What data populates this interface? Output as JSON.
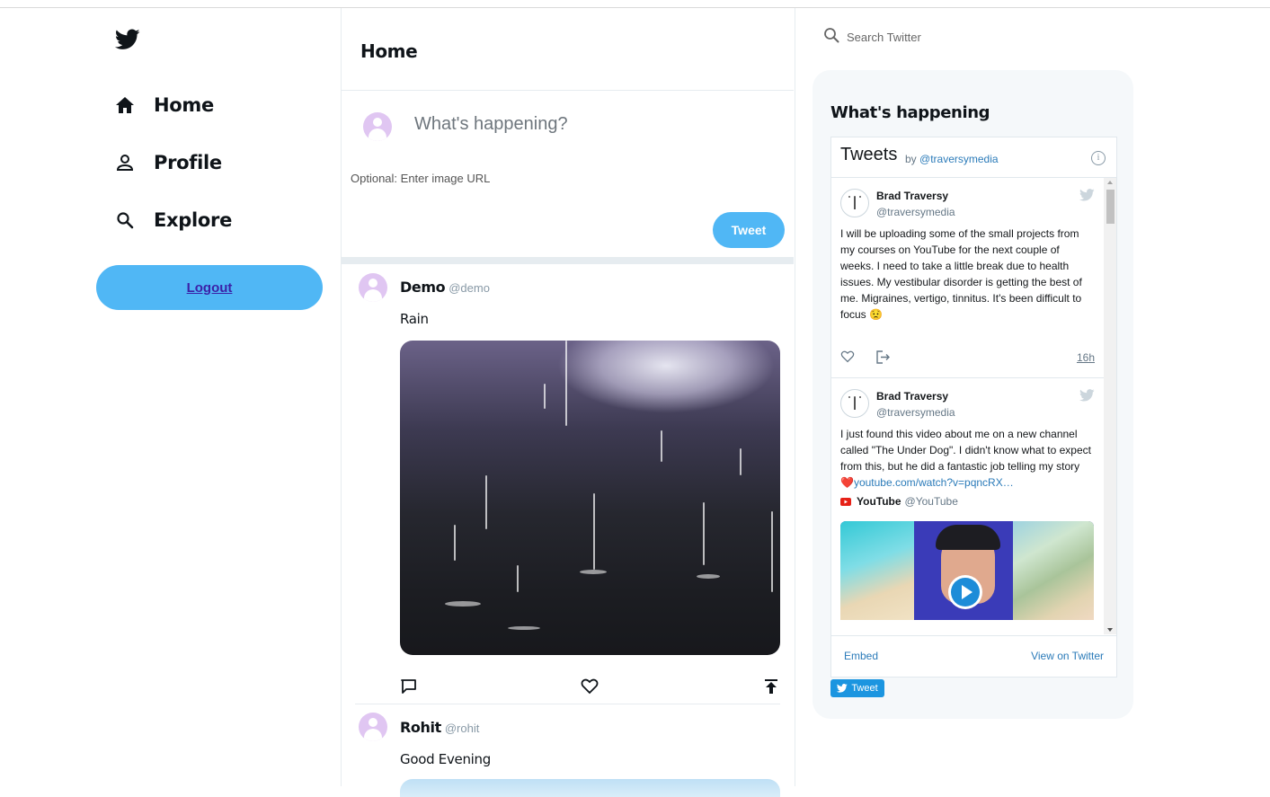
{
  "sidebar": {
    "logo": "twitter-bird-icon",
    "items": [
      {
        "label": "Home",
        "icon": "home-icon"
      },
      {
        "label": "Profile",
        "icon": "person-icon"
      },
      {
        "label": "Explore",
        "icon": "search-icon"
      }
    ],
    "logout_label": "Logout"
  },
  "feed": {
    "title": "Home",
    "compose": {
      "placeholder": "What's happening?",
      "image_url_placeholder": "Optional: Enter image URL",
      "tweet_label": "Tweet"
    },
    "posts": [
      {
        "name": "Demo",
        "handle": "@demo",
        "text": "Rain",
        "has_image": true
      },
      {
        "name": "Rohit",
        "handle": "@rohit",
        "text": "Good Evening",
        "has_image": true
      }
    ]
  },
  "right": {
    "search_placeholder": "Search Twitter",
    "widget_title": "What's happening",
    "timeline": {
      "title": "Tweets",
      "by_prefix": "by",
      "by_handle": "@traversymedia",
      "info": "i",
      "tweets": [
        {
          "name": "Brad Traversy",
          "handle": "@traversymedia",
          "text": "I will be uploading some of the small projects from my courses on YouTube for the next couple of weeks. I need to take a little break due to health issues. My vestibular disorder is getting the best of me. Migraines, vertigo, tinnitus. It's been difficult to focus",
          "emoji": "😟",
          "time": "16h"
        },
        {
          "name": "Brad Traversy",
          "handle": "@traversymedia",
          "text": "I just found this video about me on a new channel called \"The Under Dog\". I didn't know what to expect from this, but he did a fantastic job telling my story",
          "heart": "❤️",
          "link": "youtube.com/watch?v=pqncRX…",
          "card_name": "YouTube",
          "card_handle": "@YouTube"
        }
      ],
      "embed_label": "Embed",
      "view_label": "View on Twitter"
    },
    "share_label": "Tweet"
  },
  "colors": {
    "accent": "#50b7f5",
    "avatar": "#e0c6f2",
    "link": "#2b7bb9",
    "widget_bg": "#f5f8fa"
  }
}
